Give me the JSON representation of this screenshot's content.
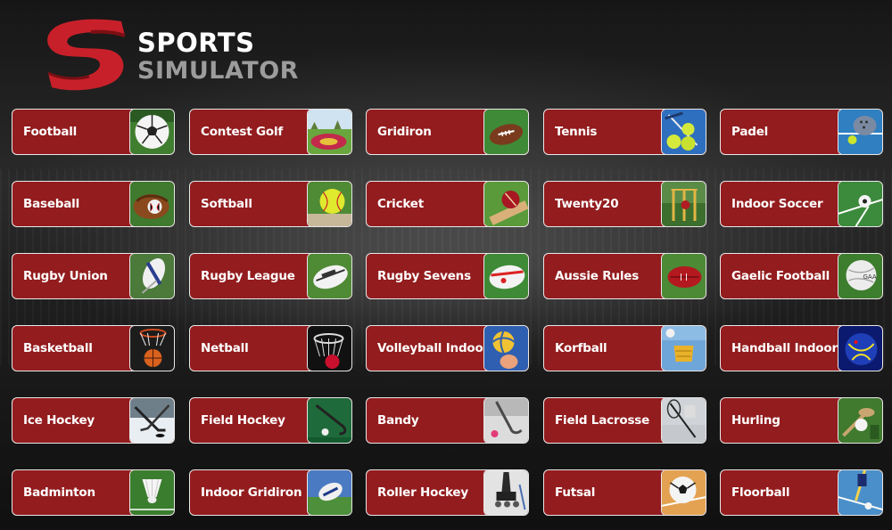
{
  "logo": {
    "line1": "SPORTS",
    "line2": "SIMULATOR"
  },
  "colors": {
    "tile": "#931c1e",
    "tile_border": "#e8e8e8",
    "logo_red": "#c8202a"
  },
  "sports": [
    {
      "label": "Football",
      "icon": "soccer-ball-icon"
    },
    {
      "label": "Contest Golf",
      "icon": "golf-green-icon"
    },
    {
      "label": "Gridiron",
      "icon": "american-football-icon"
    },
    {
      "label": "Tennis",
      "icon": "tennis-balls-icon"
    },
    {
      "label": "Padel",
      "icon": "padel-icon"
    },
    {
      "label": "Baseball",
      "icon": "baseball-glove-icon"
    },
    {
      "label": "Softball",
      "icon": "softball-icon"
    },
    {
      "label": "Cricket",
      "icon": "cricket-ball-icon"
    },
    {
      "label": "Twenty20",
      "icon": "cricket-stumps-icon"
    },
    {
      "label": "Indoor Soccer",
      "icon": "indoor-soccer-icon"
    },
    {
      "label": "Rugby Union",
      "icon": "rugby-ball-icon"
    },
    {
      "label": "Rugby League",
      "icon": "rugby-league-ball-icon"
    },
    {
      "label": "Rugby Sevens",
      "icon": "rugby-sevens-ball-icon"
    },
    {
      "label": "Aussie Rules",
      "icon": "aussie-rules-ball-icon"
    },
    {
      "label": "Gaelic Football",
      "icon": "gaelic-ball-icon"
    },
    {
      "label": "Basketball",
      "icon": "basketball-hoop-icon"
    },
    {
      "label": "Netball",
      "icon": "netball-hoop-icon"
    },
    {
      "label": "Volleyball Indoor",
      "icon": "volleyball-icon"
    },
    {
      "label": "Korfball",
      "icon": "korfball-basket-icon"
    },
    {
      "label": "Handball Indoor",
      "icon": "handball-icon"
    },
    {
      "label": "Ice Hockey",
      "icon": "ice-hockey-stick-icon"
    },
    {
      "label": "Field Hockey",
      "icon": "field-hockey-stick-icon"
    },
    {
      "label": "Bandy",
      "icon": "bandy-stick-icon"
    },
    {
      "label": "Field Lacrosse",
      "icon": "lacrosse-icon"
    },
    {
      "label": "Hurling",
      "icon": "hurling-icon"
    },
    {
      "label": "Badminton",
      "icon": "shuttlecock-icon"
    },
    {
      "label": "Indoor Gridiron",
      "icon": "indoor-gridiron-icon"
    },
    {
      "label": "Roller Hockey",
      "icon": "roller-hockey-icon"
    },
    {
      "label": "Futsal",
      "icon": "futsal-ball-icon"
    },
    {
      "label": "Floorball",
      "icon": "floorball-icon"
    }
  ]
}
